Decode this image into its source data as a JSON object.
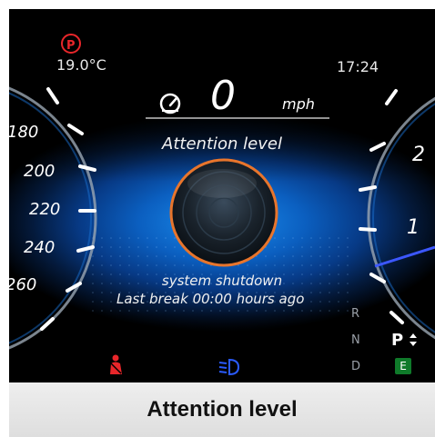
{
  "status": {
    "temperature": "19.0°C",
    "clock": "17:24",
    "parking_brake_icon": "parking-brake-icon"
  },
  "speed": {
    "value": "0",
    "unit": "mph"
  },
  "attention": {
    "title": "Attention level",
    "status_line": "system shutdown",
    "last_break_line": "Last break 00:00 hours ago"
  },
  "speedometer_ticks": [
    "180",
    "200",
    "220",
    "240",
    "260"
  ],
  "tachometer_ticks": [
    "2",
    "1"
  ],
  "gear": {
    "r": "R",
    "n": "N",
    "p": "P",
    "d": "D",
    "mode": "E"
  },
  "indicators": {
    "seatbelt": "seatbelt-warning-icon",
    "headlight": "low-beam-icon"
  },
  "colors": {
    "warning_red": "#e8262a",
    "headlight_blue": "#2a5bff",
    "eco_green": "#0f7a2a",
    "accent_orange": "#e8752c"
  },
  "banner": {
    "text": "Attention level"
  }
}
